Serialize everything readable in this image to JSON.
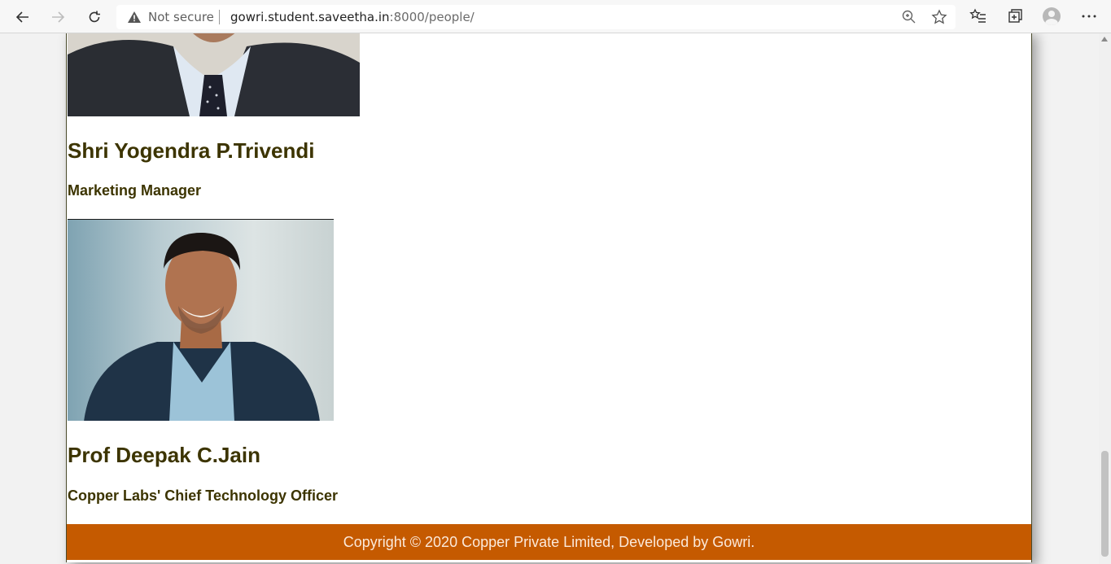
{
  "browser": {
    "security_label": "Not secure",
    "url_host": "gowri.student.saveetha.in",
    "url_rest": ":8000/people/",
    "icons": [
      "back-arrow-icon",
      "forward-arrow-icon",
      "refresh-icon",
      "warning-icon",
      "zoom-icon",
      "star-icon",
      "favorites-icon",
      "collections-icon",
      "profile-icon",
      "more-icon"
    ]
  },
  "people": [
    {
      "name": "Shri Yogendra P.Trivendi",
      "role": "Marketing Manager"
    },
    {
      "name": "Prof Deepak C.Jain",
      "role": "Copper Labs' Chief Technology Officer"
    }
  ],
  "footer": {
    "text": "Copyright © 2020 Copper Private Limited, Developed by Gowri."
  },
  "colors": {
    "heading": "#3c3400",
    "footer_bg": "#c55a00",
    "footer_text": "#fbe9da"
  }
}
